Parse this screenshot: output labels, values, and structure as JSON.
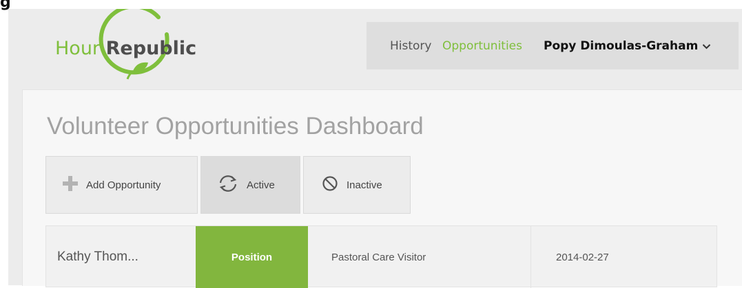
{
  "caption": "g",
  "header": {
    "logo": {
      "part1": "Hour",
      "part2": "Republic"
    },
    "nav": {
      "history": "History",
      "opportunities": "Opportunities",
      "user": "Popy Dimoulas-Graham"
    }
  },
  "main": {
    "title": "Volunteer Opportunities Dashboard",
    "buttons": {
      "add": "Add Opportunity",
      "active": "Active",
      "inactive": "Inactive"
    },
    "rows": [
      {
        "name": "Kathy Thom...",
        "badge": "Position",
        "role": "Pastoral Care Visitor",
        "date": "2014-02-27"
      }
    ]
  },
  "colors": {
    "brand_green": "#7fbf3c",
    "badge_green": "#82b63e",
    "title_gray": "#a2a2a2"
  },
  "icons": {
    "add": "plus-icon",
    "active": "refresh-icon",
    "inactive": "ban-icon",
    "user_menu": "chevron-down-icon"
  }
}
